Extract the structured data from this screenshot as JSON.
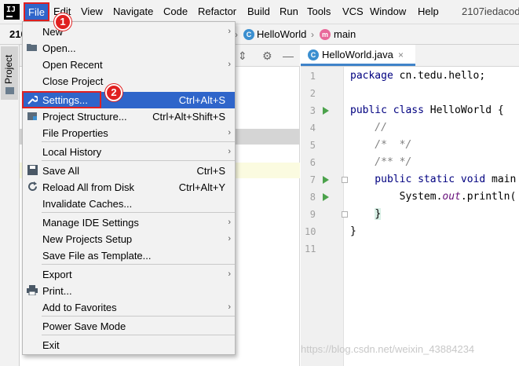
{
  "menubar": {
    "logo": "IJ",
    "items": [
      "File",
      "Edit",
      "View",
      "Navigate",
      "Code",
      "Refactor",
      "Build",
      "Run",
      "Tools",
      "VCS",
      "Window",
      "Help"
    ],
    "project_title": "2107iedacod"
  },
  "navbar": {
    "project": "210",
    "class_name": "HelloWorld",
    "method_name": "main",
    "class_icon": "class-icon",
    "method_icon": "method-icon"
  },
  "tool_window": {
    "label": "Project"
  },
  "editor": {
    "tab_label": "HelloWorld.java",
    "tab_close": "×",
    "line_numbers": [
      "1",
      "2",
      "3",
      "4",
      "5",
      "6",
      "7",
      "8",
      "9",
      "10",
      "11"
    ],
    "code": {
      "l1_kw": "package",
      "l1_rest": " cn.tedu.hello;",
      "l3_kw": "public class",
      "l3_rest": " HelloWorld {",
      "l4": "    //",
      "l5": "    /*  */",
      "l6": "    /** */",
      "l7_kw": "    public static void",
      "l7_rest": " main",
      "l8_pre": "        System.",
      "l8_out": "out",
      "l8_post": ".println(",
      "l9_pre": "    ",
      "l9_brace": "}",
      "l10": "}"
    }
  },
  "watermark": "https://blog.csdn.net/weixin_43884234",
  "file_menu": {
    "items": [
      {
        "id": "new",
        "label": "New",
        "mnemonic": "N",
        "rest": "ew",
        "submenu": true
      },
      {
        "id": "open",
        "label": "Open...",
        "icon": "folder-icon"
      },
      {
        "id": "open_recent",
        "label": "Open Recent",
        "submenu": true
      },
      {
        "id": "close_project",
        "label": "Close Project"
      },
      {
        "id": "settings",
        "label": "Settings...",
        "shortcut": "Ctrl+Alt+S",
        "icon": "wrench-icon"
      },
      {
        "id": "project_structure",
        "label": "Project Structure...",
        "shortcut": "Ctrl+Alt+Shift+S",
        "icon": "project-structure-icon"
      },
      {
        "id": "file_properties",
        "label": "File Properties",
        "submenu": true
      },
      {
        "id": "local_history",
        "label": "Local History",
        "submenu": true
      },
      {
        "id": "save_all",
        "label": "Save All",
        "shortcut": "Ctrl+S",
        "icon": "save-icon"
      },
      {
        "id": "reload",
        "label": "Reload All from Disk",
        "shortcut": "Ctrl+Alt+Y",
        "icon": "reload-icon"
      },
      {
        "id": "invalidate",
        "label": "Invalidate Caches..."
      },
      {
        "id": "manage_ide",
        "label": "Manage IDE Settings",
        "submenu": true
      },
      {
        "id": "new_projects_setup",
        "label": "New Projects Setup",
        "submenu": true
      },
      {
        "id": "save_template",
        "label": "Save File as Template..."
      },
      {
        "id": "export",
        "label": "Export",
        "submenu": true
      },
      {
        "id": "print",
        "label": "Print...",
        "icon": "printer-icon"
      },
      {
        "id": "add_favorites",
        "label": "Add to Favorites",
        "submenu": true
      },
      {
        "id": "power_save",
        "label": "Power Save Mode"
      },
      {
        "id": "exit",
        "label": "Exit"
      }
    ],
    "arrow": "›"
  },
  "callouts": [
    "1",
    "2"
  ],
  "colors": {
    "selection": "#2f65ca",
    "annotation_red": "#e02020",
    "keyword": "#000080",
    "comment": "#808080",
    "run_green": "#4ba24b"
  }
}
